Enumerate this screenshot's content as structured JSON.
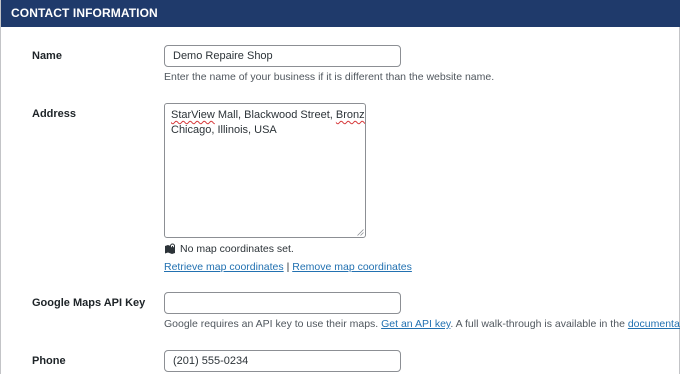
{
  "section": {
    "title": "CONTACT INFORMATION"
  },
  "name_field": {
    "label": "Name",
    "value": "Demo Repaire Shop",
    "description": "Enter the name of your business if it is different than the website name."
  },
  "address_field": {
    "label": "Address",
    "lines": [
      {
        "parts": [
          {
            "text": "StarView",
            "spell": true
          },
          {
            "text": " Mall, Blackwood Street, ",
            "spell": false
          },
          {
            "text": "Bronzeville",
            "spell": true
          },
          {
            "text": ",",
            "spell": false
          }
        ]
      },
      {
        "parts": [
          {
            "text": "Chicago, Illinois, USA",
            "spell": false
          }
        ]
      }
    ],
    "status_icon": "map-icon",
    "status_text": "No map coordinates set.",
    "retrieve_link": "Retrieve map coordinates",
    "separator": "|",
    "remove_link": "Remove map coordinates"
  },
  "api_key_field": {
    "label": "Google Maps API Key",
    "value": "",
    "description_prefix": "Google requires an API key to use their maps.",
    "get_key_link": "Get an API key",
    "description_middle": ". A full walk-through is available in the",
    "documentation_link": "documentation",
    "description_suffix": "."
  },
  "phone_field": {
    "label": "Phone",
    "value": "(201) 555-0234"
  },
  "colors": {
    "header_bg": "#1f3a6b",
    "link": "#2271b1",
    "spell_underline": "#d63638"
  }
}
